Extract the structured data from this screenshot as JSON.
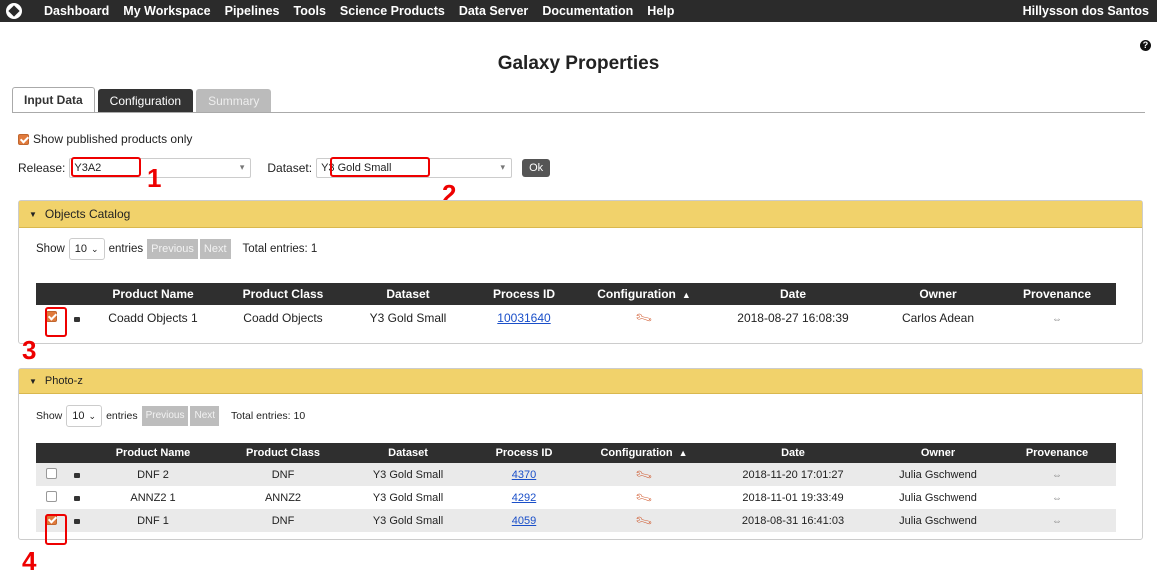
{
  "topbar": {
    "nav": [
      "Dashboard",
      "My Workspace",
      "Pipelines",
      "Tools",
      "Science Products",
      "Data Server",
      "Documentation",
      "Help"
    ],
    "user": "Hillysson dos Santos"
  },
  "page": {
    "title": "Galaxy Properties",
    "help_icon": "?"
  },
  "tabs": [
    {
      "label": "Input Data",
      "state": "active"
    },
    {
      "label": "Configuration",
      "state": "normal"
    },
    {
      "label": "Summary",
      "state": "disabled"
    }
  ],
  "filters": {
    "published_label": "Show published products only",
    "published_checked": true,
    "release_label": "Release:",
    "release_value": "Y3A2",
    "dataset_label": "Dataset:",
    "dataset_value": "Y3 Gold Small",
    "ok_label": "Ok"
  },
  "markers": [
    "1",
    "2",
    "3",
    "4"
  ],
  "objects_catalog": {
    "title": "Objects Catalog",
    "show_label": "Show",
    "entries_value": "10",
    "entries_label": "entries",
    "prev_label": "Previous",
    "next_label": "Next",
    "total": "Total entries: 1",
    "columns": [
      "",
      "",
      "Product Name",
      "Product Class",
      "Dataset",
      "Process ID",
      "Configuration",
      "Date",
      "Owner",
      "Provenance"
    ],
    "sorted_column": "Configuration",
    "rows": [
      {
        "checked": true,
        "name": "Coadd Objects 1",
        "class": "Coadd Objects",
        "dataset": "Y3 Gold Small",
        "process_id": "10031640",
        "date": "2018-08-27 16:08:39",
        "owner": "Carlos Adean"
      }
    ]
  },
  "photoz": {
    "title": "Photo-z",
    "show_label": "Show",
    "entries_value": "10",
    "entries_label": "entries",
    "prev_label": "Previous",
    "next_label": "Next",
    "total": "Total entries: 10",
    "columns": [
      "",
      "",
      "Product Name",
      "Product Class",
      "Dataset",
      "Process ID",
      "Configuration",
      "Date",
      "Owner",
      "Provenance"
    ],
    "sorted_column": "Configuration",
    "rows": [
      {
        "checked": false,
        "name": "DNF 2",
        "class": "DNF",
        "dataset": "Y3 Gold Small",
        "process_id": "4370",
        "date": "2018-11-20 17:01:27",
        "owner": "Julia Gschwend"
      },
      {
        "checked": false,
        "name": "ANNZ2 1",
        "class": "ANNZ2",
        "dataset": "Y3 Gold Small",
        "process_id": "4292",
        "date": "2018-11-01 19:33:49",
        "owner": "Julia Gschwend"
      },
      {
        "checked": true,
        "name": "DNF 1",
        "class": "DNF",
        "dataset": "Y3 Gold Small",
        "process_id": "4059",
        "date": "2018-08-31 16:41:03",
        "owner": "Julia Gschwend"
      }
    ]
  },
  "colors": {
    "accent": "#e07a3c",
    "panel_header": "#f1d26b",
    "topbar": "#2b2b2b",
    "marker": "#e00000"
  }
}
